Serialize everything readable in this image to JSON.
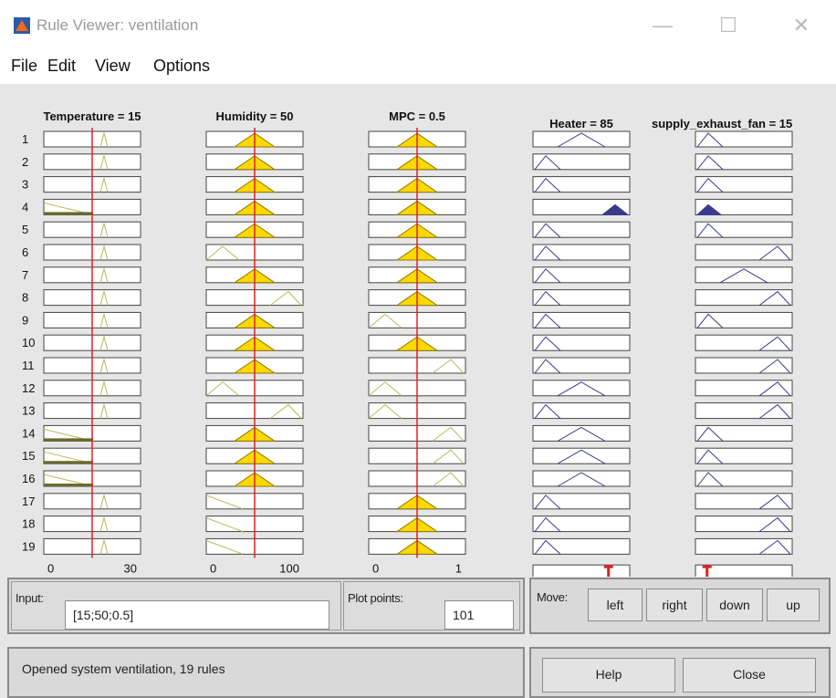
{
  "window": {
    "title": "Rule Viewer: ventilation",
    "minimize": "—",
    "maximize": "☐",
    "close": "✕"
  },
  "menu": [
    "File",
    "Edit",
    "View",
    "Options"
  ],
  "variables": [
    {
      "name": "Temperature = 15",
      "value": 15,
      "range": [
        0,
        30
      ],
      "range_labels": [
        "0",
        "30"
      ],
      "type": "input"
    },
    {
      "name": "Humidity = 50",
      "value": 50,
      "range": [
        0,
        100
      ],
      "range_labels": [
        "0",
        "100"
      ],
      "type": "input"
    },
    {
      "name": "MPC = 0.5",
      "value": 0.5,
      "range": [
        0,
        1
      ],
      "range_labels": [
        "0",
        "1"
      ],
      "type": "input"
    },
    {
      "name": "Heater = 85",
      "type": "output"
    },
    {
      "name": "supply_exhaust_fan = 15",
      "type": "output"
    }
  ],
  "rule_numbers": [
    "1",
    "2",
    "3",
    "4",
    "5",
    "6",
    "7",
    "8",
    "9",
    "10",
    "11",
    "12",
    "13",
    "14",
    "15",
    "16",
    "17",
    "18",
    "19"
  ],
  "rule_count": 19,
  "input_panel": {
    "label": "Input:",
    "value": "[15;50;0.5]",
    "plot_points_label": "Plot points:",
    "plot_points_value": "101"
  },
  "move_panel": {
    "label": "Move:",
    "buttons": [
      "left",
      "right",
      "down",
      "up"
    ]
  },
  "status_text": "Opened system ventilation, 19 rules",
  "help_label": "Help",
  "close_label": "Close",
  "colors": {
    "input_mf": "#b8b85a",
    "fill": "#ffd800",
    "output_mf": "#3a3a8c",
    "cursor": "#e02020",
    "background": "#e6e6e6"
  }
}
